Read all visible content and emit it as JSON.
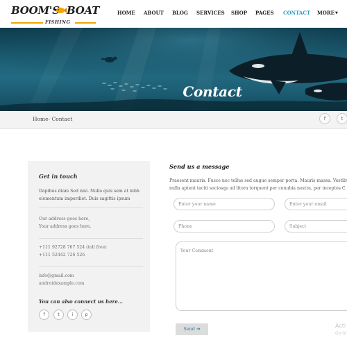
{
  "logo": {
    "word1": "BOOM'S",
    "word2": "BOAT",
    "tagline": "FISHING"
  },
  "nav": {
    "items": [
      {
        "label": "HOME"
      },
      {
        "label": "ABOUT"
      },
      {
        "label": "BLOG"
      },
      {
        "label": "SERVICES"
      },
      {
        "label": "SHOP"
      },
      {
        "label": "PAGES"
      },
      {
        "label": "CONTACT",
        "active": true
      },
      {
        "label": "MORE"
      }
    ]
  },
  "hero": {
    "title": "Contact"
  },
  "breadcrumb": {
    "text": "Home- Contact"
  },
  "share": {
    "facebook": "f",
    "twitter": "t"
  },
  "info": {
    "title": "Get in touch",
    "description": "Dapibus diam Sed nisi. Nulla quis sem at nibh elementum imperdiet. Duis sagittis ipsum",
    "address_line1": "Our address goes here,",
    "address_line2": "Your address goes here.",
    "phone1": "+111 92728 767 524 (toll free)",
    "phone2": "+111 52442 726 526",
    "email1": "info@gmail.com",
    "email2": "androidexample.com",
    "social_title": "You can also connect us here...",
    "social": [
      "f",
      "t",
      "i",
      "p"
    ]
  },
  "message": {
    "title": "Send us a message",
    "line1": "Praesent mauris. Fusce nec tellus sed augue semper porta. Mauris massa. Vestibulum",
    "line2": "nulla aptent taciti sociosqu ad litora torquent per conubia nostra, per inceptos C. C",
    "name_placeholder": "Enter your name",
    "email_placeholder": "Enter your email",
    "phone_placeholder": "Phone",
    "subject_placeholder": "Subject",
    "comment_placeholder": "Your Comment",
    "send_label": "Send",
    "send_arrow": "➔"
  },
  "overlay": {
    "activate": "Acti",
    "activate_sub": "Go to"
  },
  "colors": {
    "accent": "#2a9bc4",
    "logo_orange": "#f0a500",
    "hero_dark": "#0e3a4c",
    "card_bg": "#f2f2f2"
  }
}
